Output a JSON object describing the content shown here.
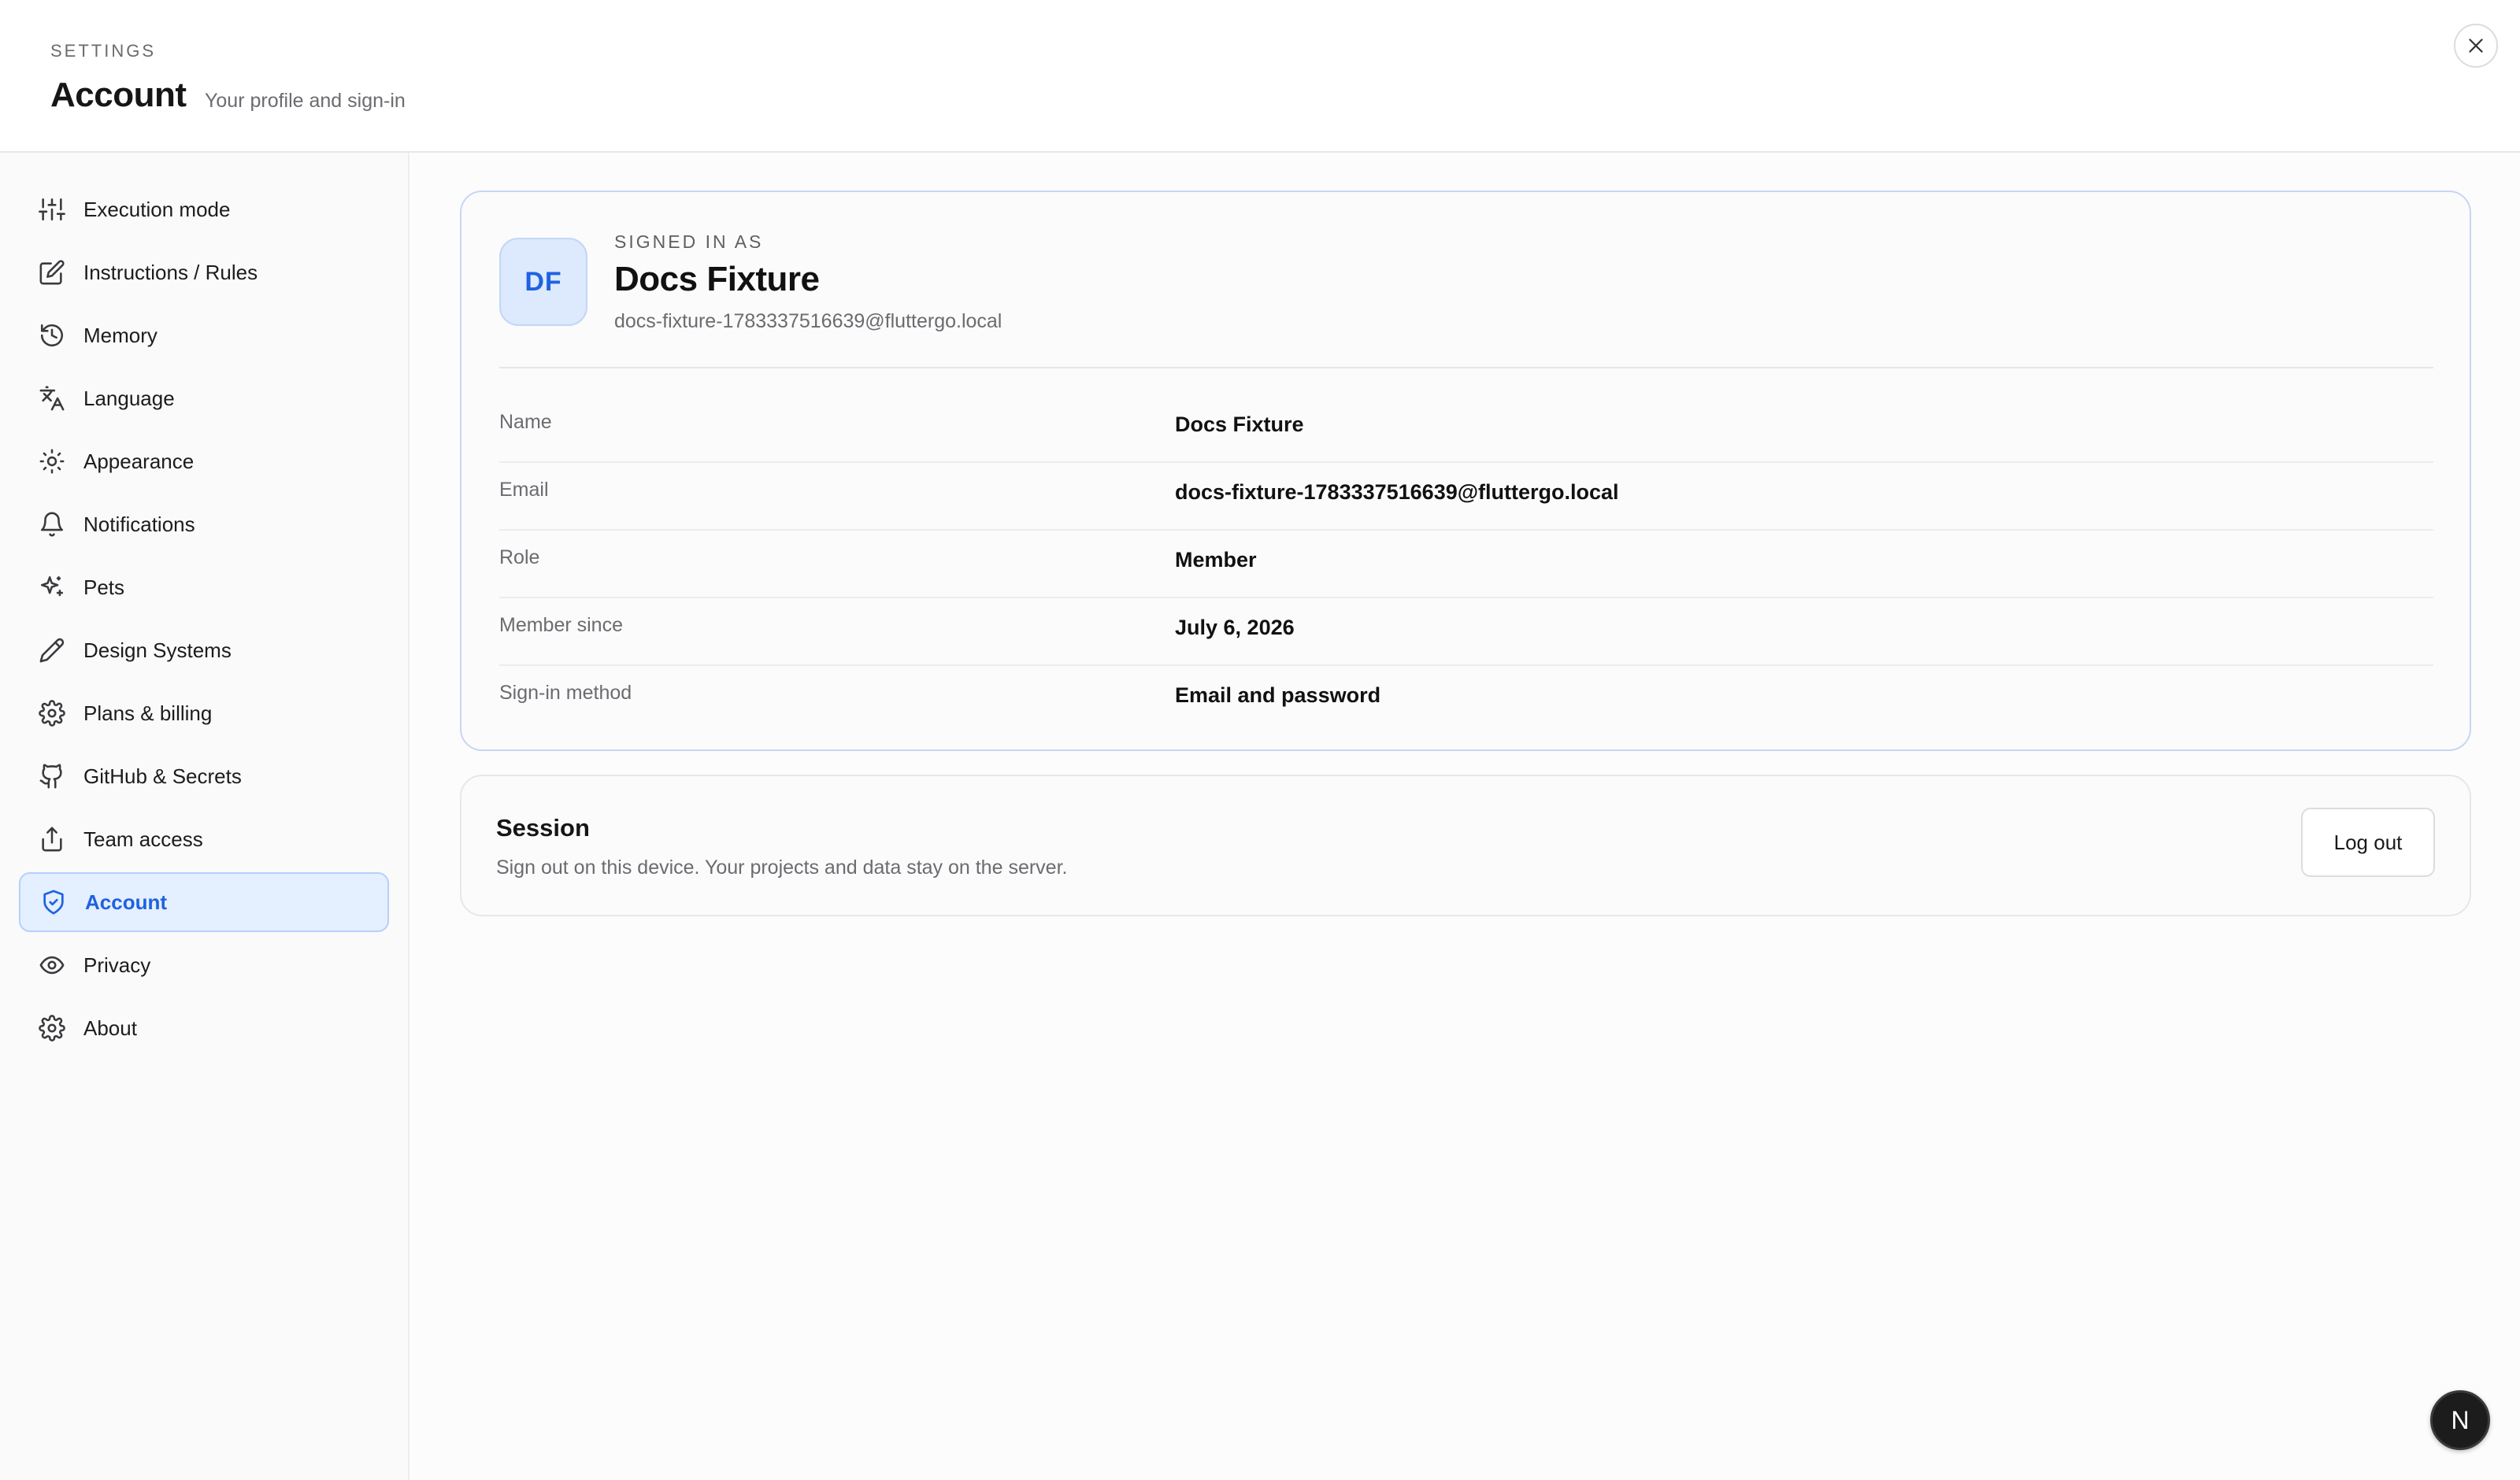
{
  "header": {
    "eyebrow": "SETTINGS",
    "title": "Account",
    "subtitle": "Your profile and sign-in"
  },
  "sidebar": {
    "items": [
      {
        "label": "Execution mode",
        "icon": "sliders-icon"
      },
      {
        "label": "Instructions / Rules",
        "icon": "edit-icon"
      },
      {
        "label": "Memory",
        "icon": "history-icon"
      },
      {
        "label": "Language",
        "icon": "translate-icon"
      },
      {
        "label": "Appearance",
        "icon": "sun-icon"
      },
      {
        "label": "Notifications",
        "icon": "bell-icon"
      },
      {
        "label": "Pets",
        "icon": "sparkles-icon"
      },
      {
        "label": "Design Systems",
        "icon": "pencil-icon"
      },
      {
        "label": "Plans & billing",
        "icon": "gear-icon"
      },
      {
        "label": "GitHub & Secrets",
        "icon": "github-icon"
      },
      {
        "label": "Team access",
        "icon": "share-icon"
      },
      {
        "label": "Account",
        "icon": "shield-check-icon",
        "active": true
      },
      {
        "label": "Privacy",
        "icon": "eye-icon"
      },
      {
        "label": "About",
        "icon": "gear-icon"
      }
    ]
  },
  "profile": {
    "avatar_initials": "DF",
    "eyebrow": "SIGNED IN AS",
    "name": "Docs Fixture",
    "email": "docs-fixture-1783337516639@fluttergo.local",
    "details": [
      {
        "label": "Name",
        "value": "Docs Fixture"
      },
      {
        "label": "Email",
        "value": "docs-fixture-1783337516639@fluttergo.local"
      },
      {
        "label": "Role",
        "value": "Member"
      },
      {
        "label": "Member since",
        "value": "July 6, 2026"
      },
      {
        "label": "Sign-in method",
        "value": "Email and password"
      }
    ]
  },
  "session": {
    "title": "Session",
    "description": "Sign out on this device. Your projects and data stay on the server.",
    "logout_label": "Log out"
  },
  "fab": {
    "label": "N"
  },
  "colors": {
    "accent": "#1f62e0",
    "active_bg": "#e4efff"
  }
}
